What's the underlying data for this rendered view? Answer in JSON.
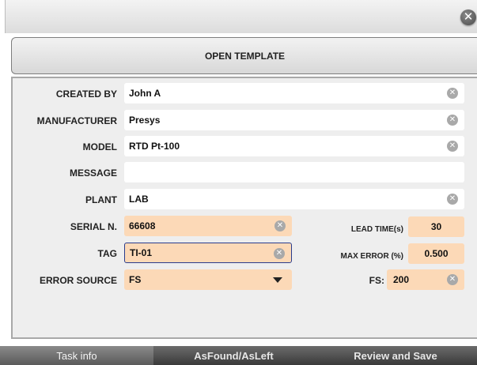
{
  "header": {
    "open_template_label": "OPEN TEMPLATE",
    "close_glyph": "✕"
  },
  "form": {
    "created_by": {
      "label": "CREATED BY",
      "value": "John A"
    },
    "manufacturer": {
      "label": "MANUFACTURER",
      "value": "Presys"
    },
    "model": {
      "label": "MODEL",
      "value": "RTD Pt-100"
    },
    "message": {
      "label": "MESSAGE",
      "value": ""
    },
    "plant": {
      "label": "PLANT",
      "value": "LAB"
    },
    "serial": {
      "label": "SERIAL N.",
      "value": "66608"
    },
    "tag": {
      "label": "TAG",
      "value": "TI-01"
    },
    "error_source": {
      "label": "ERROR SOURCE",
      "value": "FS"
    },
    "lead_time": {
      "label": "LEAD TIME(s)",
      "value": "30"
    },
    "max_error": {
      "label": "MAX ERROR (%)",
      "value": "0.500"
    },
    "fs": {
      "label": "FS:",
      "value": "200"
    }
  },
  "tabs": [
    {
      "label": "Task info"
    },
    {
      "label": "AsFound/AsLeft"
    },
    {
      "label": "Review and Save"
    }
  ],
  "colors": {
    "input_bg": "#ffffff",
    "editable_bg": "#fcd9b7",
    "focus_border": "#2a3c8c",
    "panel_bg": "#eeeeee",
    "tabbar_bg": "#1e1e1e"
  }
}
